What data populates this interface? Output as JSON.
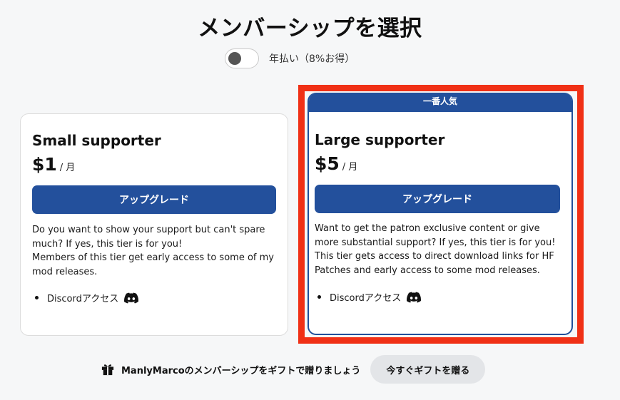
{
  "page": {
    "title": "メンバーシップを選択"
  },
  "billing": {
    "toggle_on": false,
    "label": "年払い（8%お得）"
  },
  "tiers": [
    {
      "name": "Small supporter",
      "price": "$1",
      "period": "/ 月",
      "button": "アップグレード",
      "description": [
        "Do you want to show your support but can't spare much? If yes, this tier is for you!",
        "Members of this tier get early access to some of my mod releases."
      ],
      "benefits": [
        {
          "label": "Discordアクセス",
          "icon": "discord-icon"
        }
      ]
    },
    {
      "badge": "一番人気",
      "name": "Large supporter",
      "price": "$5",
      "period": "/ 月",
      "button": "アップグレード",
      "description": [
        "Want to get the patron exclusive content or give more substantial support? If yes, this tier is for you!",
        "This tier gets access to direct download links for HF Patches and early access to some mod releases."
      ],
      "benefits": [
        {
          "label": "Discordアクセス",
          "icon": "discord-icon"
        }
      ]
    }
  ],
  "gift": {
    "icon": "gift-icon",
    "text": "ManlyMarcoのメンバーシップをギフトで贈りましょう",
    "button": "今すぐギフトを贈る"
  },
  "colors": {
    "accent": "#23509c",
    "highlight": "#f03016",
    "background": "#f6f7f8"
  }
}
